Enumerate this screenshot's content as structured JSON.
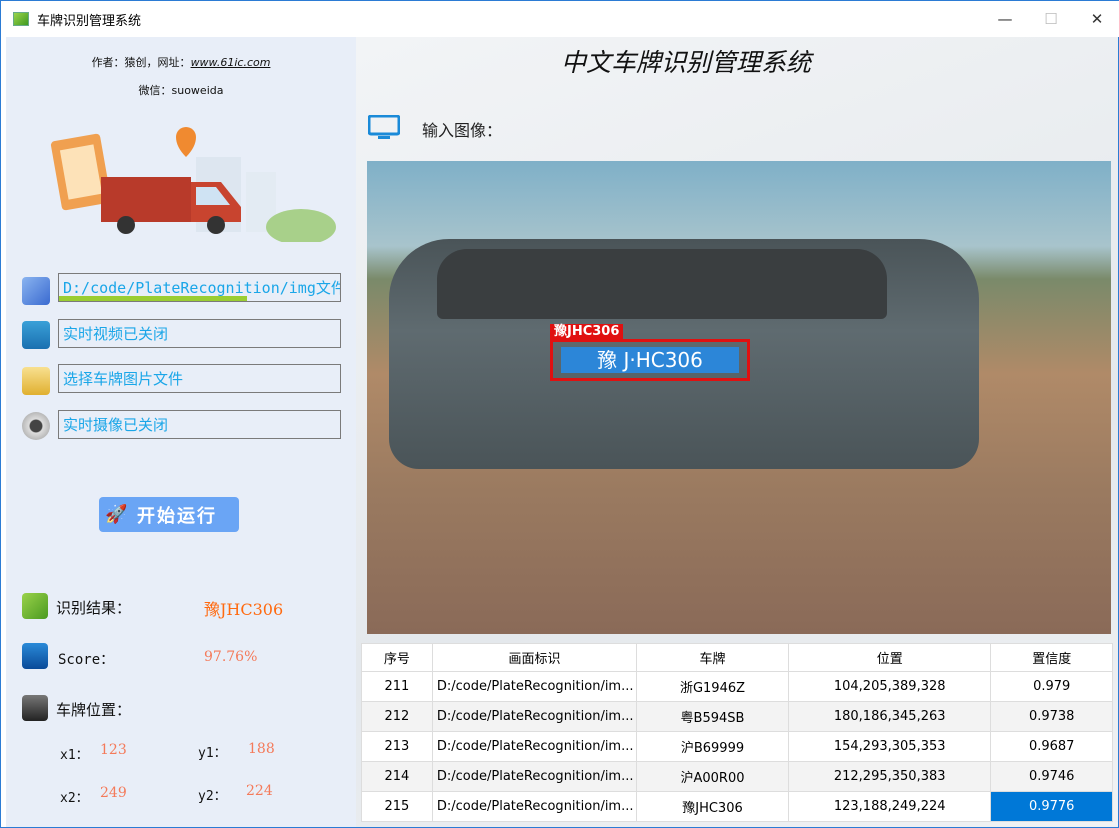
{
  "window": {
    "title": "车牌识别管理系统",
    "minimize": "—",
    "maximize": "☐",
    "close": "✕"
  },
  "left": {
    "author_prefix": "作者：猿创，网址：",
    "author_link": "www.61ic.com",
    "wechat": "微信：suoweida",
    "folder_path": "D:/code/PlateRecognition/img文件夹已",
    "folder_progress": 0.67,
    "video_status": "实时视频已关闭",
    "select_file": "选择车牌图片文件",
    "camera_status": "实时摄像已关闭",
    "run_button": "开始运行",
    "result_label": "识别结果：",
    "result_value": "豫JHC306",
    "score_label": "Score：",
    "score_value": "97.76%",
    "position_label": "车牌位置：",
    "x1_label": "x1：",
    "x1": "123",
    "y1_label": "y1：",
    "y1": "188",
    "x2_label": "x2：",
    "x2": "249",
    "y2_label": "y2：",
    "y2": "224"
  },
  "main": {
    "heading": "中文车牌识别管理系统",
    "input_label": "输入图像：",
    "plate_tag": "豫JHC306",
    "plate_text": "豫 J·HC306",
    "table": {
      "headers": [
        "序号",
        "画面标识",
        "车牌",
        "位置",
        "置信度"
      ],
      "rows": [
        [
          "211",
          "D:/code/PlateRecognition/im...",
          "浙G1946Z",
          "104,205,389,328",
          "0.979"
        ],
        [
          "212",
          "D:/code/PlateRecognition/im...",
          "粤B594SB",
          "180,186,345,263",
          "0.9738"
        ],
        [
          "213",
          "D:/code/PlateRecognition/im...",
          "沪B69999",
          "154,293,305,353",
          "0.9687"
        ],
        [
          "214",
          "D:/code/PlateRecognition/im...",
          "沪A00R00",
          "212,295,350,383",
          "0.9746"
        ],
        [
          "215",
          "D:/code/PlateRecognition/im...",
          "豫JHC306",
          "123,188,249,224",
          "0.9776"
        ]
      ]
    }
  }
}
